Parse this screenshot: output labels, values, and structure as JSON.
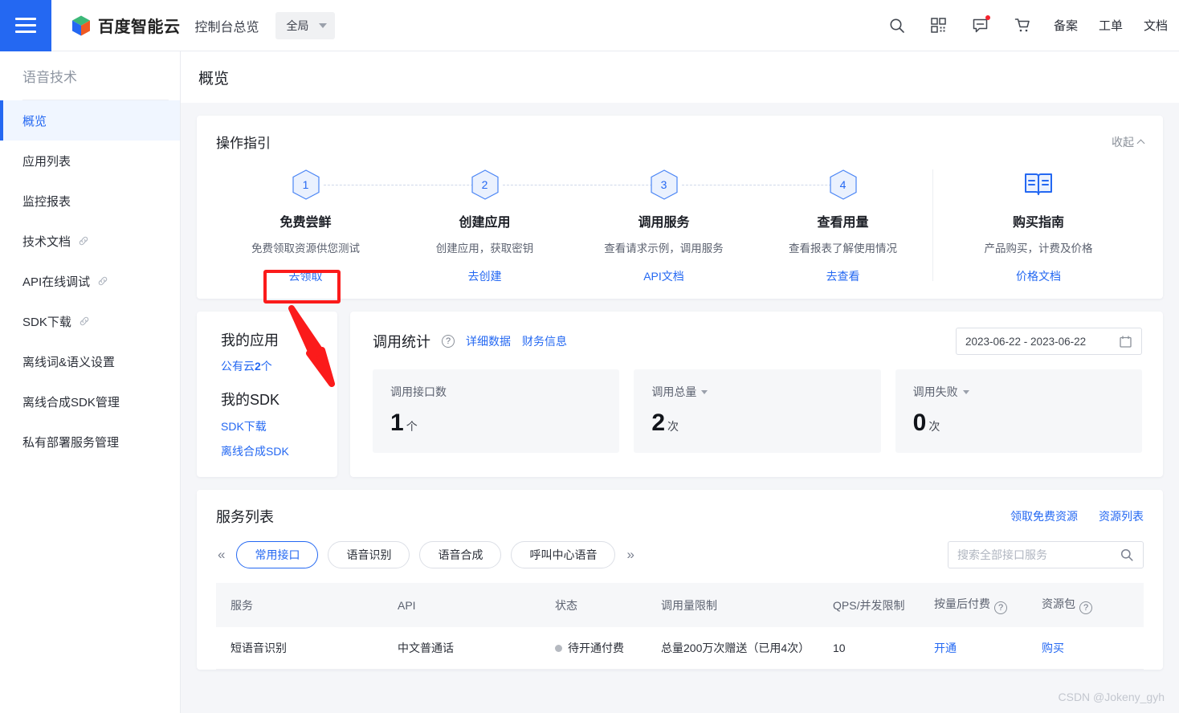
{
  "header": {
    "menu_icon": "hamburger-icon",
    "brand_name": "百度智能云",
    "console_title": "控制台总览",
    "region": "全局",
    "icons": [
      "search-icon",
      "apps-grid-icon",
      "message-icon",
      "cart-icon"
    ],
    "links": [
      "备案",
      "工单",
      "文档"
    ]
  },
  "sidebar": {
    "group_title": "语音技术",
    "items": [
      {
        "label": "概览",
        "active": true,
        "external": false
      },
      {
        "label": "应用列表",
        "active": false,
        "external": false
      },
      {
        "label": "监控报表",
        "active": false,
        "external": false
      },
      {
        "label": "技术文档",
        "active": false,
        "external": true
      },
      {
        "label": "API在线调试",
        "active": false,
        "external": true
      },
      {
        "label": "SDK下载",
        "active": false,
        "external": true
      },
      {
        "label": "离线词&语义设置",
        "active": false,
        "external": false
      },
      {
        "label": "离线合成SDK管理",
        "active": false,
        "external": false
      },
      {
        "label": "私有部署服务管理",
        "active": false,
        "external": false
      }
    ]
  },
  "page": {
    "title": "概览"
  },
  "guide": {
    "title": "操作指引",
    "collapse_label": "收起",
    "steps": [
      {
        "num": "1",
        "name": "免费尝鲜",
        "desc": "免费领取资源供您测试",
        "link": "去领取"
      },
      {
        "num": "2",
        "name": "创建应用",
        "desc": "创建应用，获取密钥",
        "link": "去创建"
      },
      {
        "num": "3",
        "name": "调用服务",
        "desc": "查看请求示例，调用服务",
        "link": "API文档"
      },
      {
        "num": "4",
        "name": "查看用量",
        "desc": "查看报表了解使用情况",
        "link": "去查看"
      }
    ],
    "buy_guide": {
      "icon": "book-icon",
      "name": "购买指南",
      "desc": "产品购买，计费及价格",
      "link": "价格文档"
    }
  },
  "my_app": {
    "title": "我的应用",
    "public_cloud_prefix": "公有云",
    "public_cloud_count": "2",
    "public_cloud_suffix": "个",
    "sdk_title": "我的SDK",
    "sdk_links": [
      "SDK下载",
      "离线合成SDK"
    ]
  },
  "stats": {
    "title": "调用统计",
    "help_icon": "question-circle-icon",
    "links": [
      "详细数据",
      "财务信息"
    ],
    "date_range": "2023-06-22 - 2023-06-22",
    "calendar_icon": "calendar-icon",
    "tiles": [
      {
        "label": "调用接口数",
        "value": "1",
        "unit": "个",
        "has_caret": false
      },
      {
        "label": "调用总量",
        "value": "2",
        "unit": "次",
        "has_caret": true
      },
      {
        "label": "调用失败",
        "value": "0",
        "unit": "次",
        "has_caret": true
      }
    ]
  },
  "services": {
    "title": "服务列表",
    "actions": [
      "领取免费资源",
      "资源列表"
    ],
    "prev_icon": "double-chevron-left-icon",
    "next_icon": "double-chevron-right-icon",
    "tabs": [
      {
        "label": "常用接口",
        "active": true
      },
      {
        "label": "语音识别",
        "active": false
      },
      {
        "label": "语音合成",
        "active": false
      },
      {
        "label": "呼叫中心语音",
        "active": false
      }
    ],
    "search_placeholder": "搜索全部接口服务",
    "search_value": "",
    "search_icon": "search-icon",
    "columns": [
      {
        "label": "服务",
        "help": false
      },
      {
        "label": "API",
        "help": false
      },
      {
        "label": "状态",
        "help": false
      },
      {
        "label": "调用量限制",
        "help": false
      },
      {
        "label": "QPS/并发限制",
        "help": false
      },
      {
        "label": "按量后付费",
        "help": true
      },
      {
        "label": "资源包",
        "help": true
      }
    ],
    "rows": [
      {
        "service": "短语音识别",
        "api": "中文普通话",
        "status": "待开通付费",
        "status_color": "#b5b9c0",
        "quota": "总量200万次赠送（已用4次）",
        "qps": "10",
        "pay": "开通",
        "package": "购买"
      }
    ]
  },
  "annotations": {
    "highlight_target": "去领取",
    "box_color": "#fb1b1b",
    "arrow_color": "#fb1b1b"
  },
  "watermark": "CSDN @Jokeny_gyh"
}
